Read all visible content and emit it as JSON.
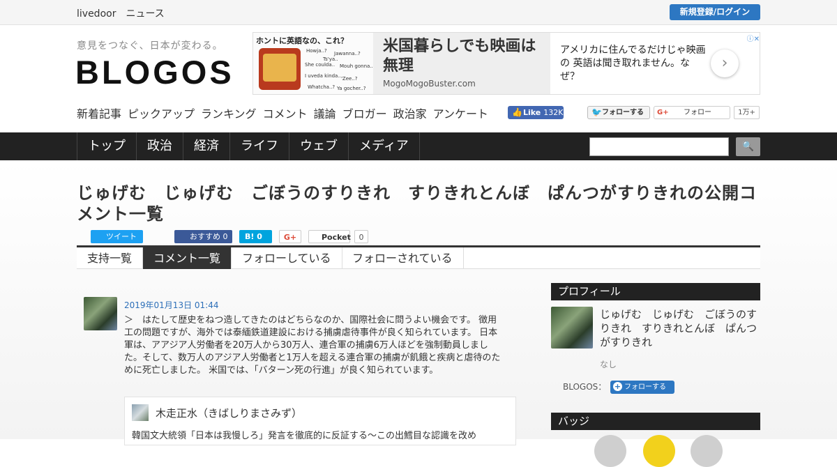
{
  "topbar": {
    "brand": "livedoor　ニュース",
    "login": "新規登録/ログイン"
  },
  "header": {
    "tagline": "意見をつなぐ、日本が変わる。",
    "logo": "BLOGOS"
  },
  "ad": {
    "thumb_caption": "ホントに英語なの、これ？",
    "bubbles": [
      "Howja..?",
      "Jawanna..?",
      "She coulda..",
      "Mouh gonna..",
      "I uveda kinda..",
      "'Zee..?",
      "Whatcha..?",
      "Ya gocher..?",
      "Ts'ya.."
    ],
    "headline": "米国暮らしでも映画は無理",
    "url": "MogoMogoBuster.com",
    "body": "アメリカに住んでるだけじゃ映画の 英語は聞き取れません。なぜ？",
    "next_icon": "›",
    "adchoice": "ⓘ✕"
  },
  "subnav": [
    "新着記事",
    "ピックアップ",
    "ランキング",
    "コメント",
    "議論",
    "ブロガー",
    "政治家",
    "アンケート"
  ],
  "social": {
    "fb_label": "Like",
    "fb_count": "132K",
    "tw_label": "フォローする",
    "gp_label": "フォロー",
    "gp_count": "1万+"
  },
  "mainnav": [
    "トップ",
    "政治",
    "経済",
    "ライフ",
    "ウェブ",
    "メディア"
  ],
  "page": {
    "title": "じゅげむ　じゅげむ　ごぼうのすりきれ　すりきれとんぼ　ぱんつがすりきれの公開コメント一覧"
  },
  "share": {
    "tweet": "ツイート",
    "fb": "おすすめ",
    "fb_count": "0",
    "hb": "B!",
    "hb_count": "0",
    "gp": "G+",
    "pocket": "Pocket",
    "pocket_count": "0"
  },
  "tabs": [
    {
      "label": "支持一覧",
      "active": false
    },
    {
      "label": "コメント一覧",
      "active": true
    },
    {
      "label": "フォローしている",
      "active": false
    },
    {
      "label": "フォローされている",
      "active": false
    }
  ],
  "comment": {
    "date": "2019年01月13日 01:44",
    "text": "＞　はたして歴史をねつ造してきたのはどちらなのか、国際社会に問うよい機会です。 徴用工の問題ですが、海外では泰緬鉄道建設における捕虜虐待事件が良く知られています。 日本軍は、アアジア人労働者を20万人から30万人、連合軍の捕虜6万人ほどを強制動員しました。そして、数万人のアジア人労働者と1万人を超える連合軍の捕虜が飢餓と疾病と虐待のために死亡しました。 米国では、「バターン死の行進」が良く知られています。",
    "quote_author": "木走正水（きばしりまさみず）",
    "quote_text": "韓国文大統領「日本は我慢しろ」発言を徹底的に反証する〜この出鱈目な認識を改め"
  },
  "sidebar": {
    "profile_head": "プロフィール",
    "profile_name": "じゅげむ　じゅげむ　ごぼうのすりきれ　すりきれとんぼ　ぱんつがすりきれ",
    "profile_desc": "なし",
    "blogos_label": "BLOGOS：",
    "follow_label": "フォローする",
    "badge_head": "バッジ"
  }
}
